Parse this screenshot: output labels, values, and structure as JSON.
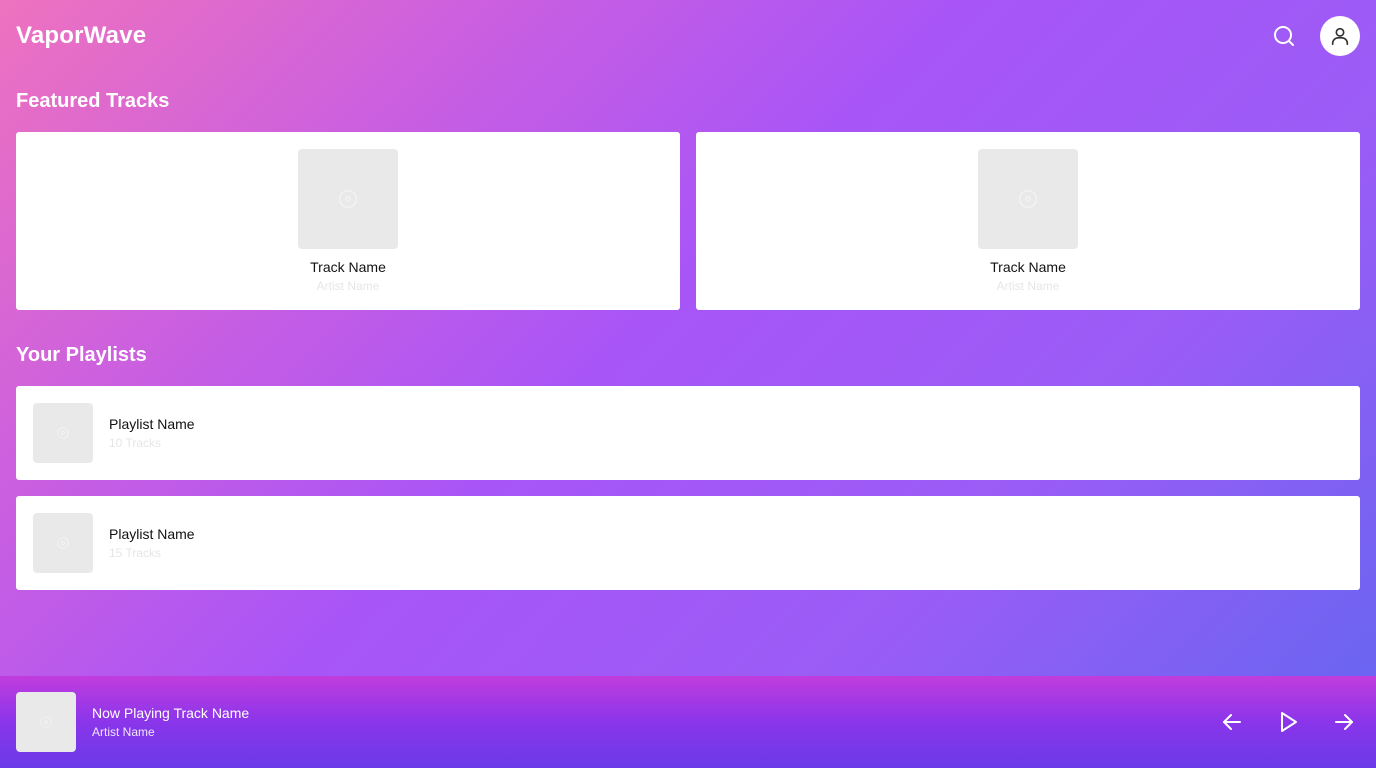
{
  "app": {
    "title": "VaporWave"
  },
  "header": {
    "search_icon": "search-icon",
    "profile_icon": "user-icon"
  },
  "featured": {
    "heading": "Featured Tracks",
    "tracks": [
      {
        "name": "Track Name",
        "artist": "Artist Name"
      },
      {
        "name": "Track Name",
        "artist": "Artist Name"
      }
    ]
  },
  "playlists": {
    "heading": "Your Playlists",
    "items": [
      {
        "name": "Playlist Name",
        "count": "10 Tracks"
      },
      {
        "name": "Playlist Name",
        "count": "15 Tracks"
      }
    ]
  },
  "player": {
    "track": "Now Playing Track Name",
    "artist": "Artist Name",
    "controls": [
      "previous-icon",
      "play-icon",
      "next-icon"
    ]
  },
  "colors": {
    "gradient_start": "#ee72bf",
    "gradient_end": "#6366f1",
    "card_bg": "#ffffff",
    "placeholder_bg": "#e9e9e9"
  }
}
